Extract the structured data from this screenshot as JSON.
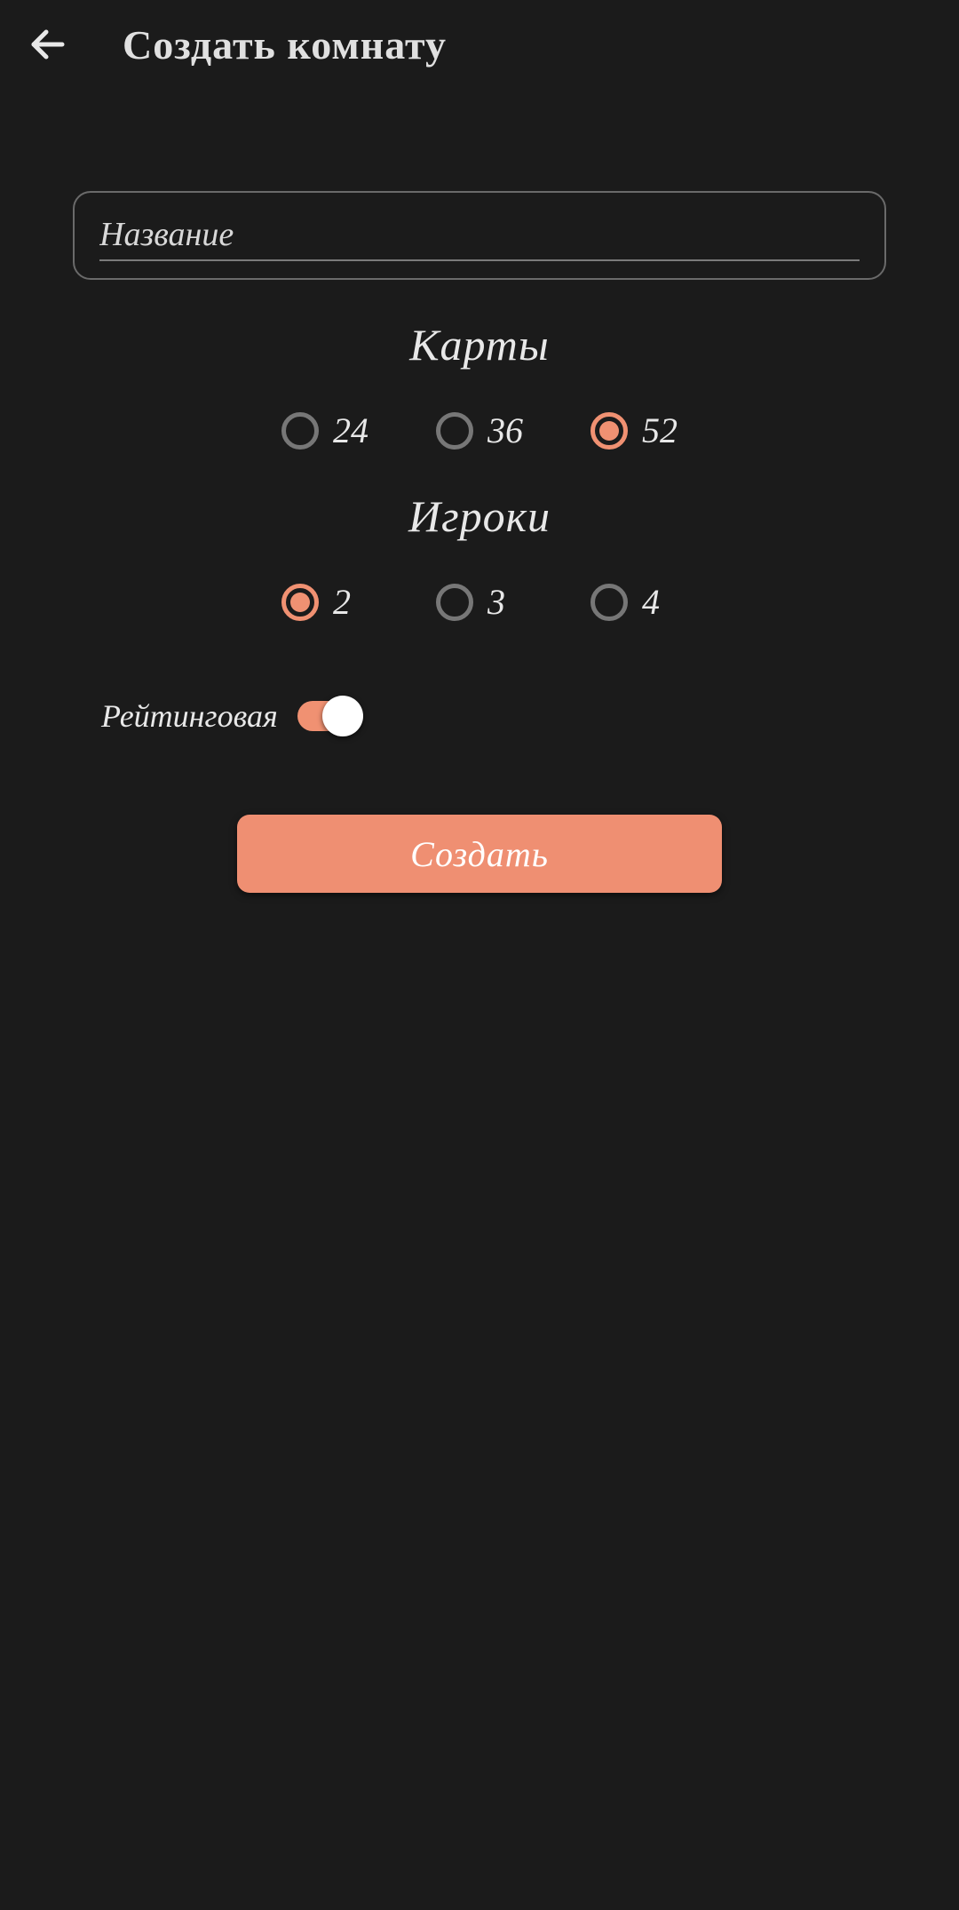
{
  "header": {
    "title": "Создать комнату"
  },
  "name_field": {
    "value": "",
    "placeholder": "Название"
  },
  "cards": {
    "title": "Карты",
    "options": [
      {
        "label": "24",
        "selected": false
      },
      {
        "label": "36",
        "selected": false
      },
      {
        "label": "52",
        "selected": true
      }
    ]
  },
  "players": {
    "title": "Игроки",
    "options": [
      {
        "label": "2",
        "selected": true
      },
      {
        "label": "3",
        "selected": false
      },
      {
        "label": "4",
        "selected": false
      }
    ]
  },
  "rating_toggle": {
    "label": "Рейтинговая",
    "on": true
  },
  "create_button": {
    "label": "Создать"
  },
  "colors": {
    "accent": "#ef8f72",
    "bg": "#1b1b1b"
  }
}
